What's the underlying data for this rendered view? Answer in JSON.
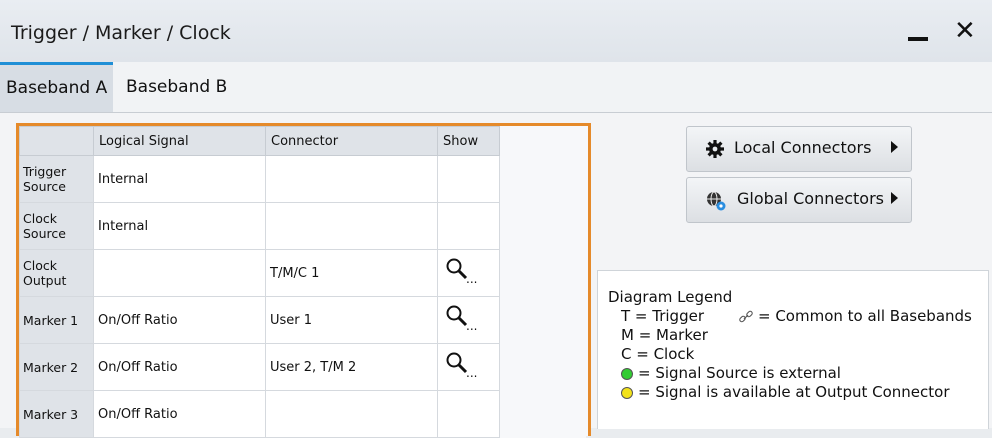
{
  "window": {
    "title": "Trigger / Marker / Clock",
    "close_glyph": "✕"
  },
  "tabs": [
    {
      "label": "Baseband A"
    },
    {
      "label": "Baseband B"
    }
  ],
  "table": {
    "headers": [
      "",
      "Logical Signal",
      "Connector",
      "Show"
    ],
    "rows": [
      {
        "name": "Trigger Source",
        "signal": "Internal",
        "connector": "",
        "show": false
      },
      {
        "name": "Clock Source",
        "signal": "Internal",
        "connector": "",
        "show": false
      },
      {
        "name": "Clock Output",
        "signal": "",
        "connector": "T/M/C 1",
        "show": true
      },
      {
        "name": "Marker 1",
        "signal": "On/Off Ratio",
        "connector": "User 1",
        "show": true
      },
      {
        "name": "Marker 2",
        "signal": "On/Off Ratio",
        "connector": "User 2, T/M 2",
        "show": true
      },
      {
        "name": "Marker 3",
        "signal": "On/Off Ratio",
        "connector": "",
        "show": false
      }
    ],
    "show_ellipsis": "..."
  },
  "buttons": {
    "local": {
      "label": "Local Connectors",
      "icon": "gear-icon"
    },
    "global": {
      "label": "Global Connectors",
      "icon": "globe-gear-icon"
    }
  },
  "legend": {
    "title": "Diagram Legend",
    "trigger": "T = Trigger",
    "common": "= Common to all Basebands",
    "marker": "M = Marker",
    "clock": "C = Clock",
    "external": "= Signal Source is external",
    "output": "= Signal is available at Output Connector",
    "colors": {
      "external": "#33cc33",
      "output": "#f2e21a"
    }
  }
}
